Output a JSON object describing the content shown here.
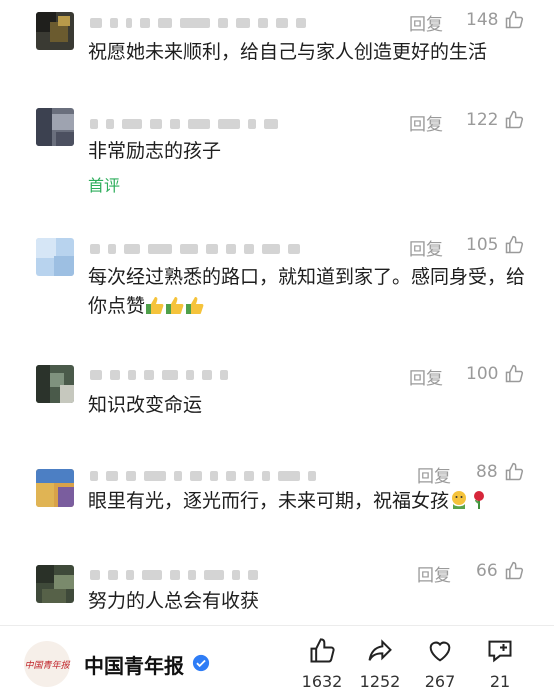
{
  "comments": [
    {
      "reply": "回复",
      "likes": "148",
      "text": "祝愿她未来顺利，给自己与家人创造更好的生活",
      "tag": ""
    },
    {
      "reply": "回复",
      "likes": "122",
      "text": "非常励志的孩子",
      "tag": "首评"
    },
    {
      "reply": "回复",
      "likes": "105",
      "text": "每次经过熟悉的路口，就知道到家了。感同身受，给你点赞",
      "tag": ""
    },
    {
      "reply": "回复",
      "likes": "100",
      "text": "知识改变命运",
      "tag": ""
    },
    {
      "reply": "回复",
      "likes": "88",
      "text": "眼里有光，逐光而行，未来可期，祝福女孩",
      "tag": ""
    },
    {
      "reply": "回复",
      "likes": "66",
      "text": "努力的人总会有收获",
      "tag": ""
    }
  ],
  "account": {
    "name": "中国青年报",
    "logo_text": "中国青年报"
  },
  "actions": {
    "like": "1632",
    "share": "1252",
    "favorite": "267",
    "comment": "21"
  },
  "icons": [
    "thumb-up-icon",
    "share-arrow-icon",
    "heart-icon",
    "add-comment-icon",
    "verified-badge-icon"
  ],
  "colors": {
    "first_tag": "#2fae5c",
    "verified": "#2f7df6",
    "muted": "#9a9a9a"
  }
}
